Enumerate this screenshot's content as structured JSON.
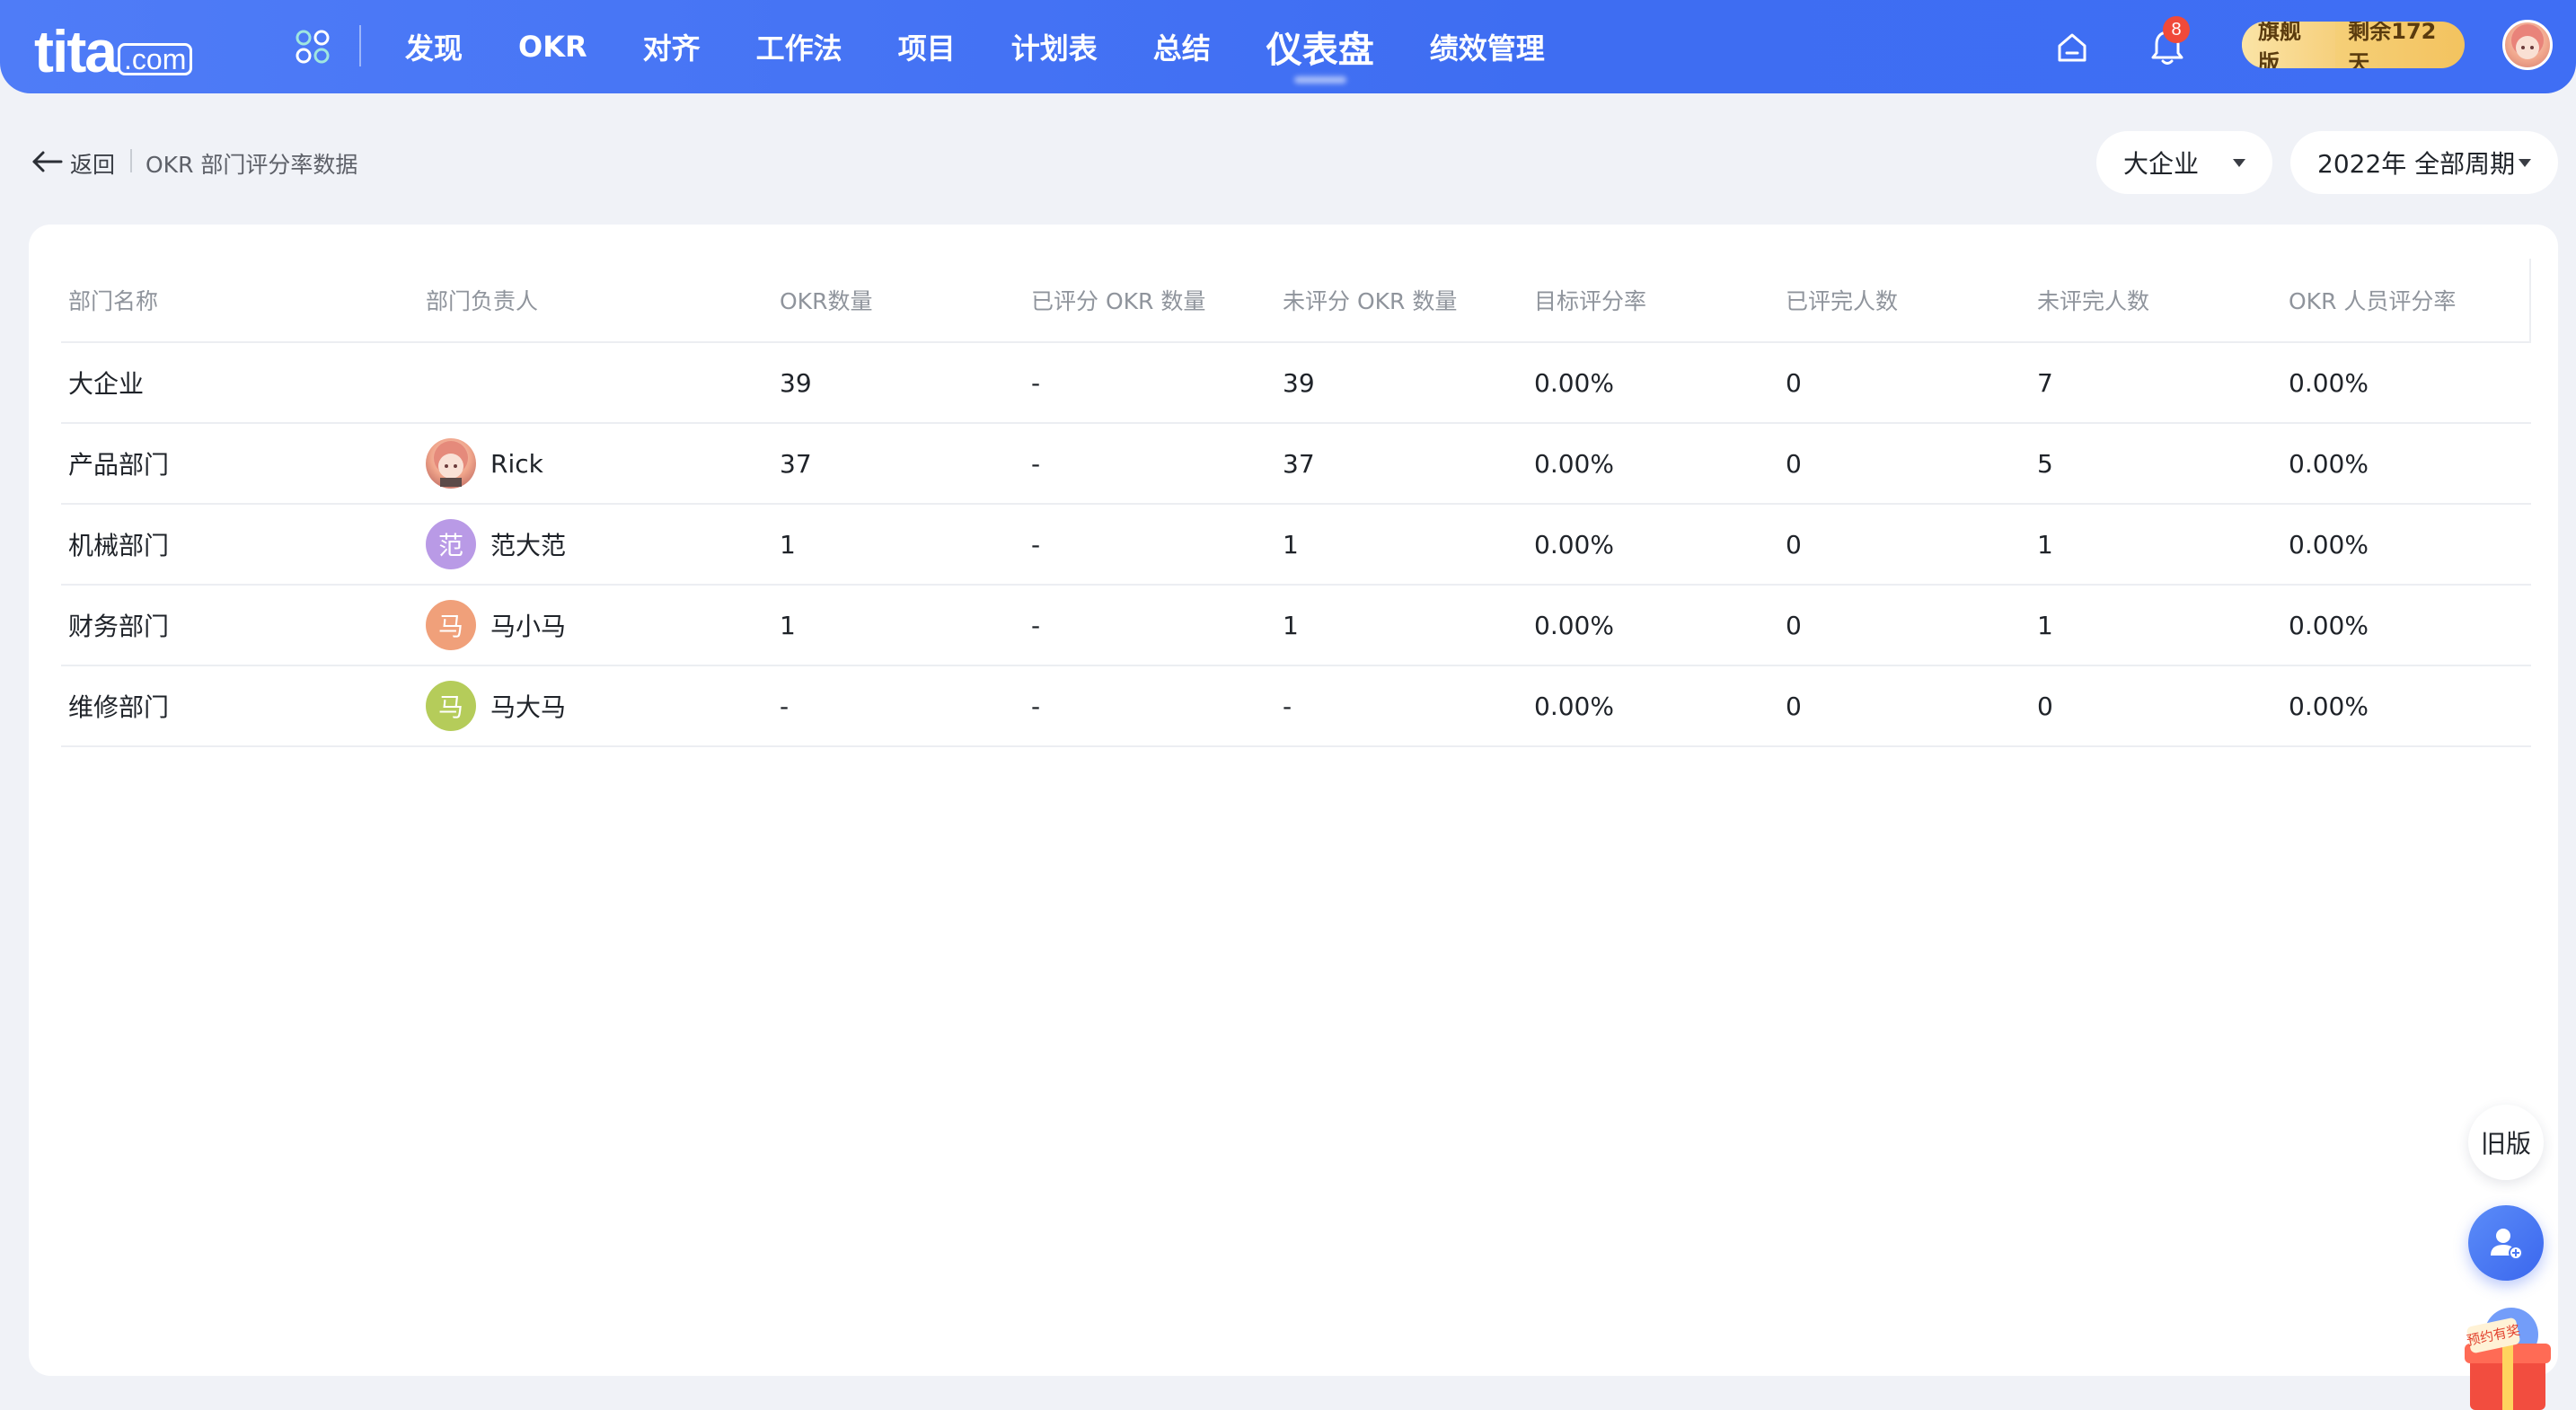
{
  "brand": {
    "logo_main": "tita",
    "logo_suffix": ".com"
  },
  "nav": {
    "items": [
      {
        "label": "发现"
      },
      {
        "label": "OKR"
      },
      {
        "label": "对齐"
      },
      {
        "label": "工作法"
      },
      {
        "label": "项目"
      },
      {
        "label": "计划表"
      },
      {
        "label": "总结"
      },
      {
        "label": "仪表盘",
        "active": true
      },
      {
        "label": "绩效管理"
      }
    ],
    "notification_count": "8",
    "plan": {
      "name": "旗舰版",
      "days_left": "剩余172天"
    }
  },
  "breadcrumb": {
    "back_label": "返回",
    "title": "OKR 部门评分率数据"
  },
  "filters": {
    "org": "大企业",
    "period": "2022年 全部周期"
  },
  "table": {
    "headers": [
      "部门名称",
      "部门负责人",
      "OKR数量",
      "已评分 OKR 数量",
      "未评分 OKR 数量",
      "目标评分率",
      "已评完人数",
      "未评完人数",
      "OKR 人员评分率"
    ],
    "rows": [
      {
        "dept": "大企业",
        "owner": "",
        "avatar_text": "",
        "avatar_color": "",
        "okr_count": "39",
        "scored": "-",
        "unscored": "39",
        "target_rate": "0.00%",
        "done_people": "0",
        "undone_people": "7",
        "people_rate": "0.00%"
      },
      {
        "dept": "产品部门",
        "owner": "Rick",
        "avatar_text": "",
        "avatar_color": "photo",
        "okr_count": "37",
        "scored": "-",
        "unscored": "37",
        "target_rate": "0.00%",
        "done_people": "0",
        "undone_people": "5",
        "people_rate": "0.00%"
      },
      {
        "dept": "机械部门",
        "owner": "范大范",
        "avatar_text": "范",
        "avatar_color": "#b99ae6",
        "okr_count": "1",
        "scored": "-",
        "unscored": "1",
        "target_rate": "0.00%",
        "done_people": "0",
        "undone_people": "1",
        "people_rate": "0.00%"
      },
      {
        "dept": "财务部门",
        "owner": "马小马",
        "avatar_text": "马",
        "avatar_color": "#f0a07a",
        "okr_count": "1",
        "scored": "-",
        "unscored": "1",
        "target_rate": "0.00%",
        "done_people": "0",
        "undone_people": "1",
        "people_rate": "0.00%"
      },
      {
        "dept": "维修部门",
        "owner": "马大马",
        "avatar_text": "马",
        "avatar_color": "#b5cc5a",
        "okr_count": "-",
        "scored": "-",
        "unscored": "-",
        "target_rate": "0.00%",
        "done_people": "0",
        "undone_people": "0",
        "people_rate": "0.00%"
      }
    ]
  },
  "floating": {
    "old_version_label": "旧版",
    "gift_label": "预约有奖"
  },
  "icons": [
    "apps-grid-icon",
    "home-icon",
    "bell-icon",
    "back-arrow-icon",
    "caret-down-icon",
    "add-user-icon",
    "gift-icon"
  ],
  "colors": {
    "nav_blue": "#3f6ef4",
    "page_bg": "#f0f2f7",
    "badge_red": "#f04a3a",
    "plan_gold": "#f3c35f"
  }
}
